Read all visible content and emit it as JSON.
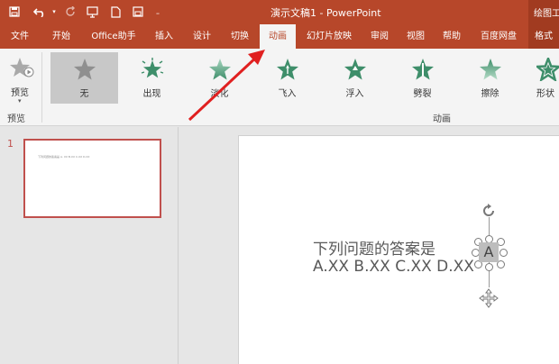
{
  "window": {
    "title": "演示文稿1  -  PowerPoint",
    "context_tab": "绘图工"
  },
  "quick_access": {
    "save_icon": "save-icon",
    "undo_icon": "undo-icon",
    "redo_icon": "redo-icon",
    "present_icon": "present-from-start-icon",
    "new_icon": "new-document-icon",
    "saveas_icon": "save-icon"
  },
  "tabs": [
    "文件",
    "开始",
    "Office助手",
    "插入",
    "设计",
    "切换",
    "动画",
    "幻灯片放映",
    "审阅",
    "视图",
    "帮助",
    "百度网盘",
    "格式"
  ],
  "active_tab": "动画",
  "ribbon": {
    "preview_label": "预览",
    "preview_group": "预览",
    "animation_group": "动画",
    "animations": [
      "无",
      "出现",
      "淡化",
      "飞入",
      "浮入",
      "劈裂",
      "擦除",
      "形状"
    ],
    "selected_animation": "无"
  },
  "thumbnails": {
    "slide_number": "1",
    "thumb_text": "下列问题的答案是 A. XX B.XX C.XX D.XX"
  },
  "slide": {
    "line1": "下列问题的答案是",
    "line2": "A.XX B.XX C.XX D.XX",
    "shape_letter": "A"
  },
  "colors": {
    "brand": "#b7472a",
    "accent_red": "#c0504d",
    "star_green": "#3e8e6a"
  }
}
